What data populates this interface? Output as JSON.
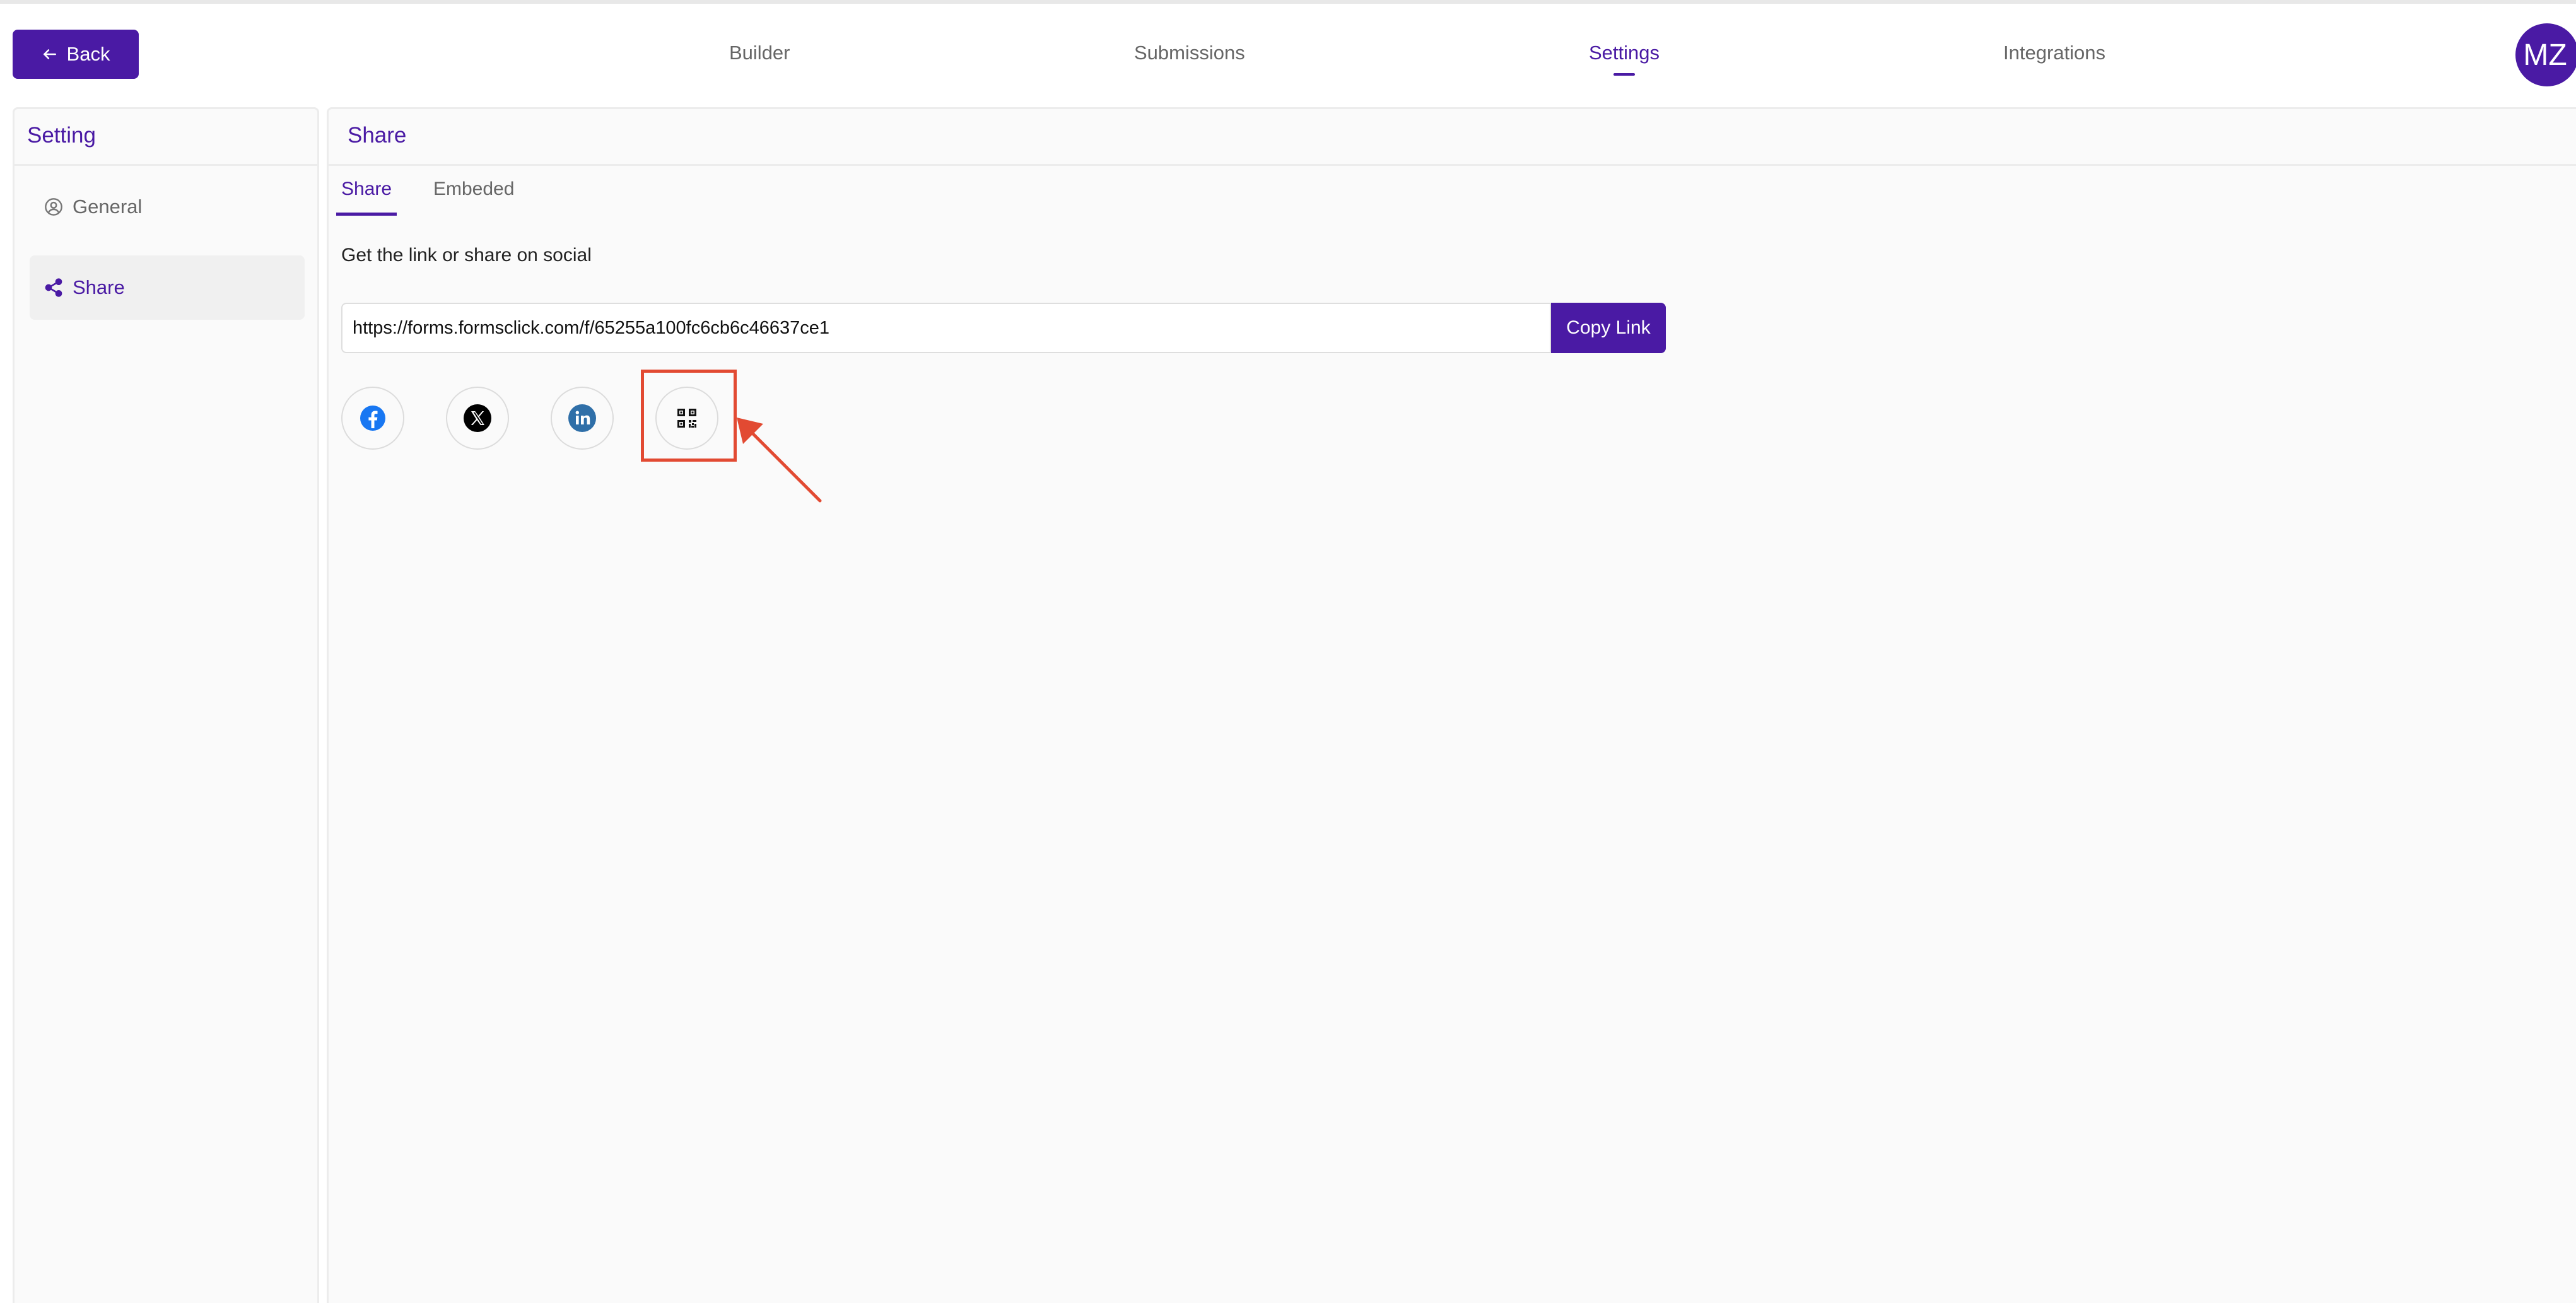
{
  "header": {
    "back_label": "Back",
    "nav": [
      {
        "label": "Builder"
      },
      {
        "label": "Submissions"
      },
      {
        "label": "Settings",
        "active": true
      },
      {
        "label": "Integrations"
      }
    ],
    "avatar_initials": "MZ"
  },
  "sidebar": {
    "title": "Setting",
    "items": [
      {
        "label": "General",
        "icon": "user-circle-icon"
      },
      {
        "label": "Share",
        "icon": "share-icon",
        "active": true
      }
    ]
  },
  "main": {
    "title": "Share",
    "tabs": [
      {
        "label": "Share",
        "active": true
      },
      {
        "label": "Embeded"
      }
    ],
    "description": "Get the link or share on social",
    "share_link": "https://forms.formsclick.com/f/65255a100fc6cb6c46637ce1",
    "copy_label": "Copy Link",
    "social": [
      {
        "icon": "facebook-icon"
      },
      {
        "icon": "x-twitter-icon"
      },
      {
        "icon": "linkedin-icon"
      },
      {
        "icon": "qr-code-icon",
        "highlighted": true
      }
    ]
  },
  "colors": {
    "accent": "#4a1aa4",
    "annotation": "#e24a32",
    "facebook": "#1877f2",
    "linkedin": "#2f6fa8"
  }
}
